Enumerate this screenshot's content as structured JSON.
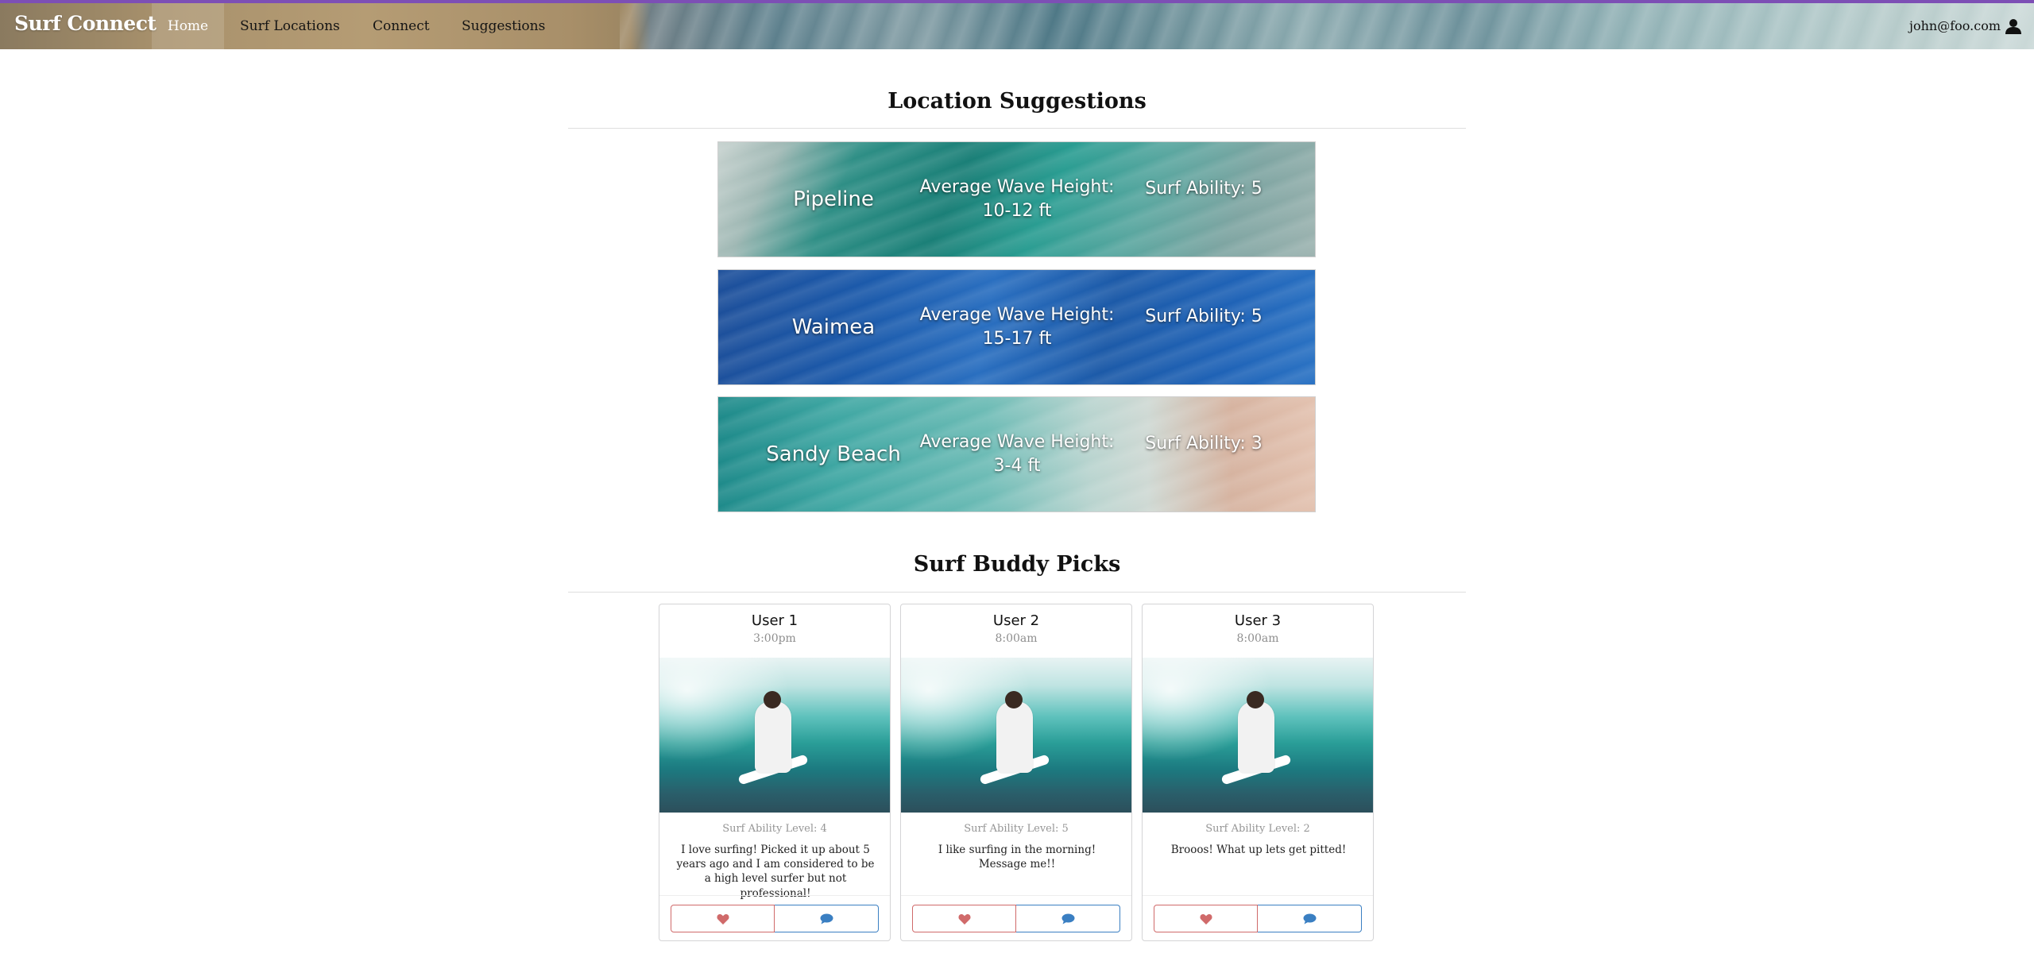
{
  "navbar": {
    "brand": "Surf Connect",
    "items": [
      {
        "label": "Home",
        "active": true
      },
      {
        "label": "Surf Locations"
      },
      {
        "label": "Connect"
      },
      {
        "label": "Suggestions"
      }
    ],
    "user_email": "john@foo.com",
    "user_icon": "user-icon"
  },
  "location_section": {
    "title": "Location Suggestions",
    "locations": [
      {
        "name": "Pipeline",
        "height": "Average Wave Height: 10-12 ft",
        "ability": "Surf Ability: 5"
      },
      {
        "name": "Waimea",
        "height": "Average Wave Height: 15-17 ft",
        "ability": "Surf Ability: 5"
      },
      {
        "name": "Sandy Beach",
        "height": "Average Wave Height: 3-4 ft",
        "ability": "Surf Ability: 3"
      }
    ]
  },
  "buddy_section": {
    "title": "Surf Buddy Picks",
    "cards": [
      {
        "name": "User 1",
        "time": "3:00pm",
        "level": "Surf Ability Level: 4",
        "bio": "I love surfing! Picked it up about 5 years ago and I am considered to be a high level surfer but not professional!"
      },
      {
        "name": "User 2",
        "time": "8:00am",
        "level": "Surf Ability Level: 5",
        "bio": "I like surfing in the morning! Message me!!"
      },
      {
        "name": "User 3",
        "time": "8:00am",
        "level": "Surf Ability Level: 2",
        "bio": "Brooos! What up lets get pitted!"
      }
    ],
    "like_icon": "heart-icon",
    "message_icon": "comment-icon"
  },
  "colors": {
    "nav_accent": "#7d4fb5",
    "like": "#d06a6a",
    "message": "#3a7fc2"
  }
}
